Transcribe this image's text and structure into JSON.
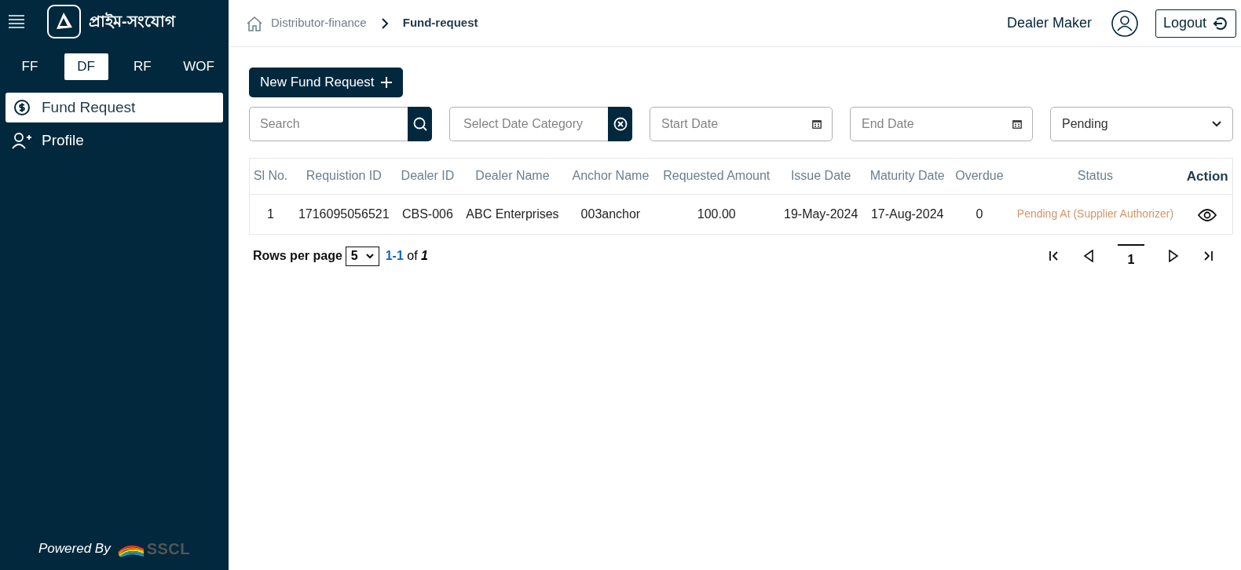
{
  "sidebar": {
    "brand": "প্রাইম-সংযোগ",
    "tabs": [
      {
        "label": "FF",
        "selected": false
      },
      {
        "label": "DF",
        "selected": true
      },
      {
        "label": "RF",
        "selected": false
      },
      {
        "label": "WOF",
        "selected": false
      }
    ],
    "items": [
      {
        "label": "Fund Request",
        "kind": "fund",
        "selected": true
      },
      {
        "label": "Profile",
        "kind": "profile",
        "selected": false
      }
    ],
    "footer": {
      "powered_by": "Powered By",
      "logo_text": "SSCL"
    }
  },
  "header": {
    "breadcrumbs": [
      {
        "label": "Distributor-finance",
        "current": false
      },
      {
        "label": "Fund-request",
        "current": true
      }
    ],
    "user_name": "Dealer Maker",
    "logout": "Logout"
  },
  "new_button": "New Fund Request",
  "filters": {
    "search": {
      "placeholder": "Search"
    },
    "date_category": {
      "placeholder": "Select Date Category"
    },
    "start_date": {
      "placeholder": "Start Date"
    },
    "end_date": {
      "placeholder": "End Date"
    },
    "status": {
      "value": "Pending"
    }
  },
  "table": {
    "columns": [
      "Sl No.",
      "Requistion ID",
      "Dealer ID",
      "Dealer Name",
      "Anchor Name",
      "Requested Amount",
      "Issue Date",
      "Maturity Date",
      "Overdue",
      "Status",
      "Action"
    ],
    "rows": [
      {
        "cells": [
          "1",
          "1716095056521",
          "CBS-006",
          "ABC Enterprises",
          "003anchor",
          "100.00",
          "19-May-2024",
          "17-Aug-2024",
          "0",
          "Pending At (Supplier Authorizer)"
        ]
      }
    ]
  },
  "pagination": {
    "rows_per_page_label": "Rows per page",
    "rows_per_page": "5",
    "range": "1-1",
    "of": "of",
    "total": "1",
    "pages": [
      {
        "label": "1",
        "selected": true
      }
    ]
  }
}
